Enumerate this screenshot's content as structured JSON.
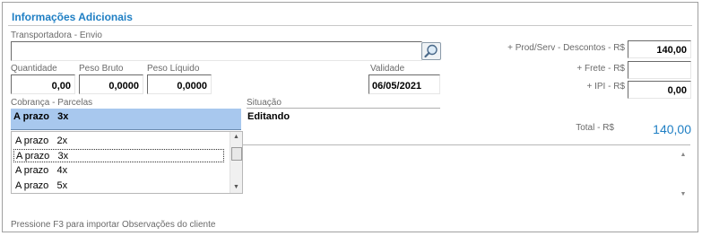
{
  "section": {
    "title": "Informações Adicionais"
  },
  "transportadora": {
    "label": "Transportadora - Envio",
    "value": ""
  },
  "quantidade": {
    "label": "Quantidade",
    "value": "0,00"
  },
  "peso_bruto": {
    "label": "Peso Bruto",
    "value": "0,0000"
  },
  "peso_liquido": {
    "label": "Peso Líquido",
    "value": "0,0000"
  },
  "validade": {
    "label": "Validade",
    "value": "06/05/2021"
  },
  "cobranca": {
    "label": "Cobrança - Parcelas",
    "selected": "A prazo   3x",
    "options": [
      "A prazo   2x",
      "A prazo   3x",
      "A prazo   4x",
      "A prazo   5x"
    ],
    "active_index": 1
  },
  "situacao": {
    "label": "Situação",
    "value": "Editando"
  },
  "totals": {
    "prod_serv_label": "+ Prod/Serv - Descontos - R$",
    "prod_serv_value": "140,00",
    "frete_label": "+ Frete - R$",
    "frete_value": "",
    "ipi_label": "+ IPI - R$",
    "ipi_value": "0,00",
    "total_label": "Total - R$",
    "total_value": "140,00"
  },
  "observacoes": {
    "value": ""
  },
  "footer": {
    "hint": "Pressione F3 para importar Observações do cliente"
  },
  "icons": {
    "search": "magnifier-icon",
    "scroll_up": "triangle-up",
    "scroll_down": "triangle-down"
  },
  "colors": {
    "title": "#1f7fc4",
    "selected_bg": "#a8c8ee",
    "total": "#1f7fc4"
  }
}
